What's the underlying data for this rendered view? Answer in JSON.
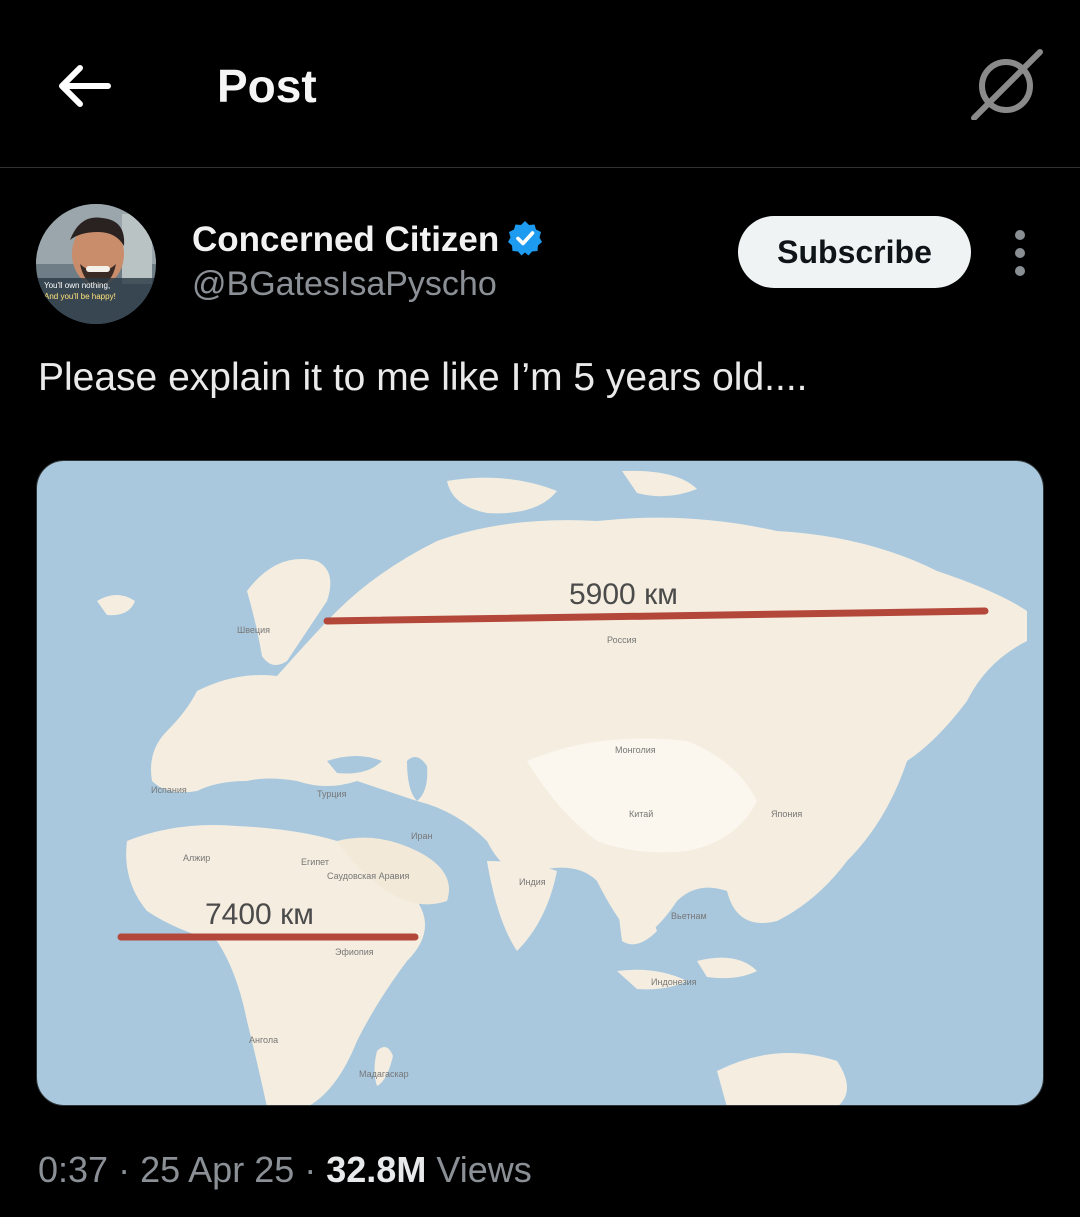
{
  "header": {
    "title": "Post"
  },
  "post": {
    "author": {
      "name": "Concerned Citizen",
      "handle": "@BGatesIsaPyscho",
      "verified": true,
      "avatar_caption_line1": "You'll own nothing,",
      "avatar_caption_line2": "And you'll be happy!"
    },
    "subscribe_label": "Subscribe",
    "text": "Please explain it to me like I’m 5 years old....",
    "media": {
      "labels": {
        "top_distance": "5900 км",
        "bottom_distance": "7400 км",
        "russia": "Россия",
        "mongolia": "Монголия",
        "china": "Китай",
        "japan": "Япония",
        "sweden": "Швеция",
        "spain": "Испания",
        "turkey": "Турция",
        "iran": "Иран",
        "algeria": "Алжир",
        "egypt": "Египет",
        "saudi": "Саудовская Аравия",
        "india": "Индия",
        "vietnam": "Вьетнам",
        "indonesia": "Индонезия",
        "ethiopia": "Эфиопия",
        "angola": "Ангола",
        "madagascar": "Мадагаскар"
      },
      "colors": {
        "ocean": "#a9c8de",
        "land": "#f5eee0",
        "line": "#b3473a"
      }
    },
    "meta": {
      "time": "0:37",
      "separator": "·",
      "date": "25 Apr 25",
      "views_count": "32.8M",
      "views_label": "Views"
    }
  }
}
